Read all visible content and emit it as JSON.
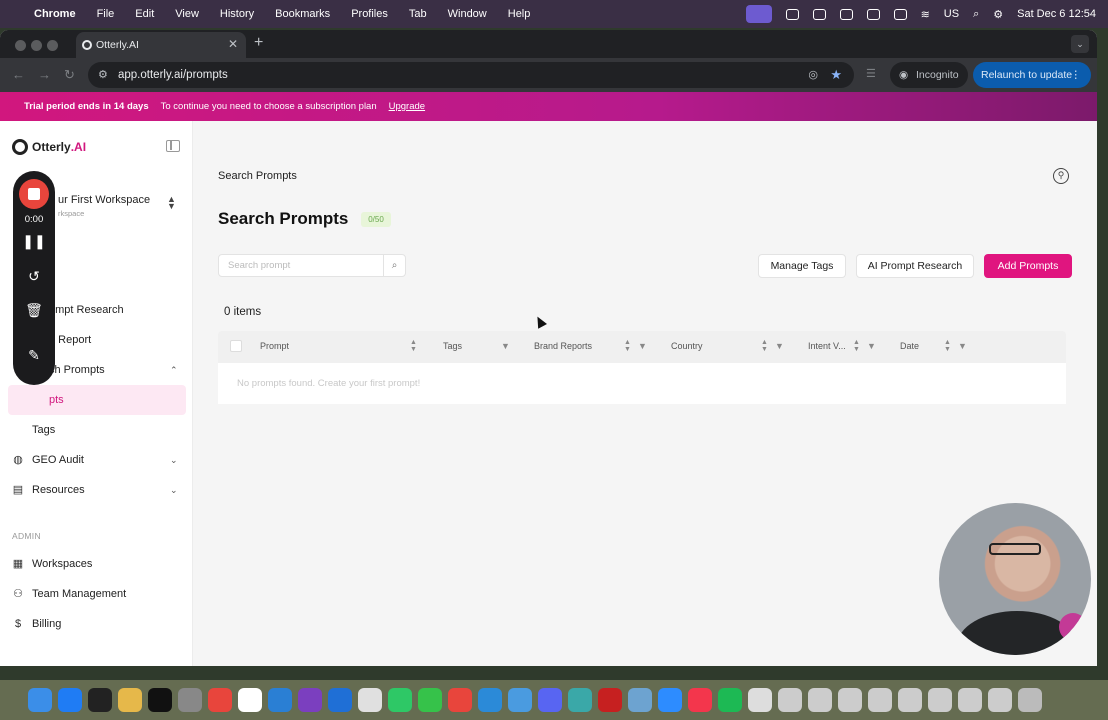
{
  "menubar": {
    "app": "Chrome",
    "items": [
      "File",
      "Edit",
      "View",
      "History",
      "Bookmarks",
      "Profiles",
      "Tab",
      "Window",
      "Help"
    ],
    "lang": "US",
    "datetime": "Sat Dec 6  12:54"
  },
  "browser": {
    "tab_title": "Otterly.AI",
    "url": "app.otterly.ai/prompts",
    "incognito_label": "Incognito",
    "relaunch_label": "Relaunch to update"
  },
  "banner": {
    "trial": "Trial period ends in 14 days",
    "message": "To continue you need to choose a subscription plan",
    "link": "Upgrade"
  },
  "sidebar": {
    "logo_main": "Otterly",
    "logo_suffix": ".AI",
    "workspace_name": "ur First Workspace",
    "workspace_sub": "rkspace",
    "items": {
      "prompt_research": "ompt Research",
      "report": "d Report",
      "search_prompts": "ch Prompts",
      "prompts": "pts",
      "tags": "Tags",
      "geo_audit": "GEO Audit",
      "resources": "Resources"
    },
    "admin_label": "ADMIN",
    "admin_items": {
      "workspaces": "Workspaces",
      "team": "Team Management",
      "billing": "Billing"
    }
  },
  "recorder": {
    "time": "0:00"
  },
  "main": {
    "breadcrumb": "Search Prompts",
    "title": "Search Prompts",
    "count_badge": "0/50",
    "search_placeholder": "Search prompt",
    "buttons": {
      "manage_tags": "Manage Tags",
      "ai_research": "AI Prompt Research",
      "add": "Add Prompts"
    },
    "items_count": "0 items",
    "columns": [
      "Prompt",
      "Tags",
      "Brand Reports",
      "Country",
      "Intent V...",
      "Date"
    ],
    "empty_message": "No prompts found. Create your first prompt!"
  },
  "colors": {
    "accent": "#e0157f",
    "banner": "#d1177e"
  }
}
